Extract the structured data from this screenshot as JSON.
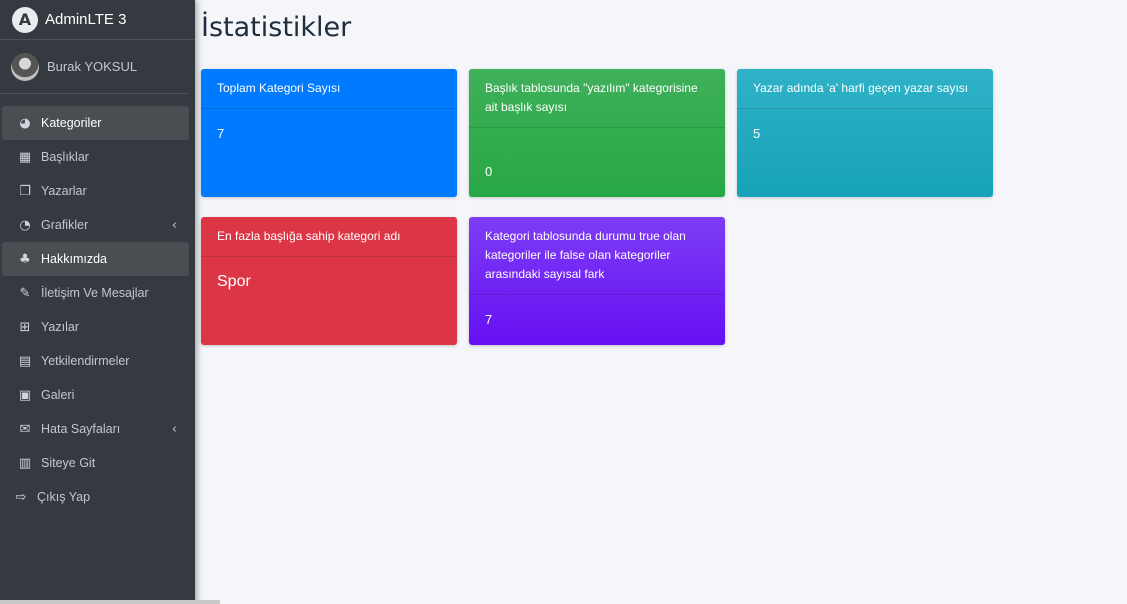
{
  "app": {
    "brand": "AdminLTE 3",
    "logo_letter": "A"
  },
  "user": {
    "name": "Burak YOKSUL"
  },
  "sidebar": {
    "items": [
      {
        "label": "Kategoriler",
        "icon": "dashboard-icon",
        "glyph": "◕"
      },
      {
        "label": "Başlıklar",
        "icon": "grid-icon",
        "glyph": "▦"
      },
      {
        "label": "Yazarlar",
        "icon": "copy-icon",
        "glyph": "❐"
      },
      {
        "label": "Grafikler",
        "icon": "pie-chart-icon",
        "glyph": "◔"
      },
      {
        "label": "Hakkımızda",
        "icon": "tree-icon",
        "glyph": "♣"
      },
      {
        "label": "İletişim Ve Mesajlar",
        "icon": "edit-icon",
        "glyph": "✎"
      },
      {
        "label": "Yazılar",
        "icon": "table-icon",
        "glyph": "⊞"
      },
      {
        "label": "Yetkilendirmeler",
        "icon": "calendar-icon",
        "glyph": "▤"
      },
      {
        "label": "Galeri",
        "icon": "image-icon",
        "glyph": "▣"
      },
      {
        "label": "Hata Sayfaları",
        "icon": "envelope-icon",
        "glyph": "✉"
      },
      {
        "label": "Siteye Git",
        "icon": "book-icon",
        "glyph": "▥"
      },
      {
        "label": "Çıkış Yap",
        "icon": "sign-out-icon",
        "glyph": "⇨"
      }
    ],
    "chevron": "‹"
  },
  "page": {
    "title": "İstatistikler"
  },
  "cards": [
    {
      "header": "Toplam Kategori Sayısı",
      "value": "7",
      "color": "#007bff"
    },
    {
      "header": "Başlık tablosunda \"yazılım\" kategorisine ait başlık sayısı",
      "value": "0",
      "color": "#28a745"
    },
    {
      "header": "Yazar adında 'a' harfi geçen yazar sayısı",
      "value": "5",
      "color": "#17a2b8"
    },
    {
      "header": "En fazla başlığa sahip kategori adı",
      "value": "Spor",
      "color": "#dc3545"
    },
    {
      "header": "Kategori tablosunda durumu true olan kategoriler ile false olan kategoriler arasındaki sayısal fark",
      "value": "7",
      "color": "#6610f2"
    }
  ]
}
